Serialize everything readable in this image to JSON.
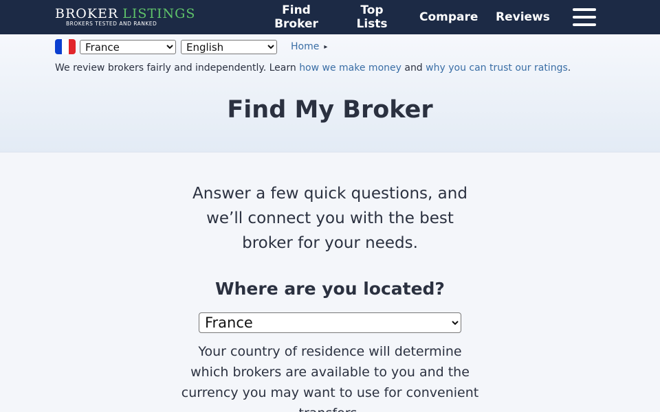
{
  "nav": {
    "logo_word1": "BROKER",
    "logo_word2": "LISTINGS",
    "logo_tagline": "BROKERS TESTED AND RANKED",
    "links": [
      {
        "label_line1": "Find",
        "label_line2": "Broker"
      },
      {
        "label_line1": "Top",
        "label_line2": "Lists"
      },
      {
        "label": "Compare"
      },
      {
        "label": "Reviews"
      }
    ],
    "menu_icon": "hamburger-menu-icon"
  },
  "toolbar": {
    "flag_icon": "france-flag-icon",
    "flag_colors": [
      "#0b3fd0",
      "#ffffff",
      "#e1262b"
    ],
    "country_selected": "France",
    "language_selected": "English",
    "breadcrumb_home": "Home",
    "breadcrumb_arrow": "▸"
  },
  "disclaimer": {
    "prefix": "We review brokers fairly and independently. Learn",
    "link1": "how we make money",
    "middle": "and",
    "link2": "why you can trust our ratings",
    "suffix": "."
  },
  "hero": {
    "title": "Find My Broker"
  },
  "main": {
    "intro": "Answer a few quick questions, and we’ll connect you with the best broker for your needs.",
    "question": "Where are you located?",
    "location_selected": "France",
    "help_text": "Your country of residence will determine which brokers are available to you and the currency you may want to use for convenient transfers."
  },
  "colors": {
    "nav_bg": "#1c2a45",
    "accent_green": "#5fc36a",
    "link_blue": "#3a6ea5"
  }
}
